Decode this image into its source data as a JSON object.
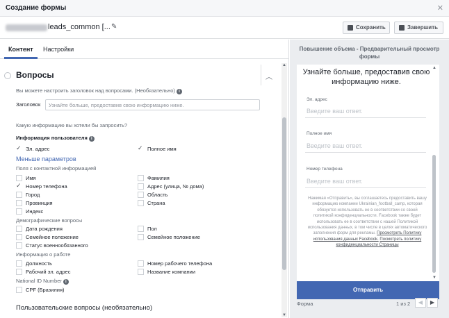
{
  "dialog": {
    "title": "Создание формы",
    "close_icon": "close-icon"
  },
  "form_name": {
    "value": "leads_common [...",
    "edit_icon": "pencil-icon"
  },
  "toolbar": {
    "save_label": "Сохранить",
    "finish_label": "Завершить"
  },
  "tabs": [
    {
      "label": "Контент"
    },
    {
      "label": "Настройки"
    }
  ],
  "questions": {
    "section_title": "Вопросы",
    "hint": "Вы можете настроить заголовок над вопросами. (Необязательно)",
    "heading_label": "Заголовок",
    "heading_placeholder": "Узнайте больше, предоставив свою информацию ниже.",
    "which_info": "Какую информацию вы хотели бы запросить?",
    "user_info_title": "Информация пользователя",
    "email": "Эл. адрес",
    "full_name": "Полное имя",
    "less_params": "Меньше параметров",
    "contact_title": "Поля с контактной информацией",
    "contact_left": [
      "Имя",
      "Номер телефона",
      "Город",
      "Провинция",
      "Индекс"
    ],
    "contact_right": [
      "Фамилия",
      "Адрес (улица, № дома)",
      "Область",
      "Страна"
    ],
    "demo_title": "Демографические вопросы",
    "demo_left": [
      "Дата рождения",
      "Семейное положение",
      "Статус военнообязанного"
    ],
    "demo_right": [
      "Пол",
      "Семейное положение"
    ],
    "work_title": "Информация о работе",
    "work_left": [
      "Должность",
      "Рабочий эл. адрес"
    ],
    "work_right": [
      "Номер рабочего телефона",
      "Название компании"
    ],
    "national_title": "National ID Number",
    "national_item": "CPF (Бразилия)",
    "custom_title": "Пользовательские вопросы (необязательно)"
  },
  "preview": {
    "header": "Повышение объема - Предварительный просмотр формы",
    "title": "Узнайте больше, предоставив свою информацию ниже.",
    "fields": [
      {
        "label": "Эл. адрес",
        "placeholder": "Введите ваш ответ."
      },
      {
        "label": "Полное имя",
        "placeholder": "Введите ваш ответ."
      },
      {
        "label": "Номер телефона",
        "placeholder": "Введите ваш ответ."
      }
    ],
    "legal_text": "Нажимая «Отправить», вы соглашаетесь предоставить вашу информацию компании Ukrainian_football_camp, которая обязуется использовать ее в соответствии со своей политикой конфиденциальности. Facebook также будет использовать ее в соответствии с нашей Политикой использования данных, в том числе в целях автоматического заполнения форм для рекламы.",
    "legal_link1": "Просмотреть Политику использования данных Facebook.",
    "legal_link2": "Посмотреть политику конфиденциальности Страницы",
    "submit_label": "Отправить",
    "footer_left": "Форма",
    "footer_page": "1 из 2"
  }
}
